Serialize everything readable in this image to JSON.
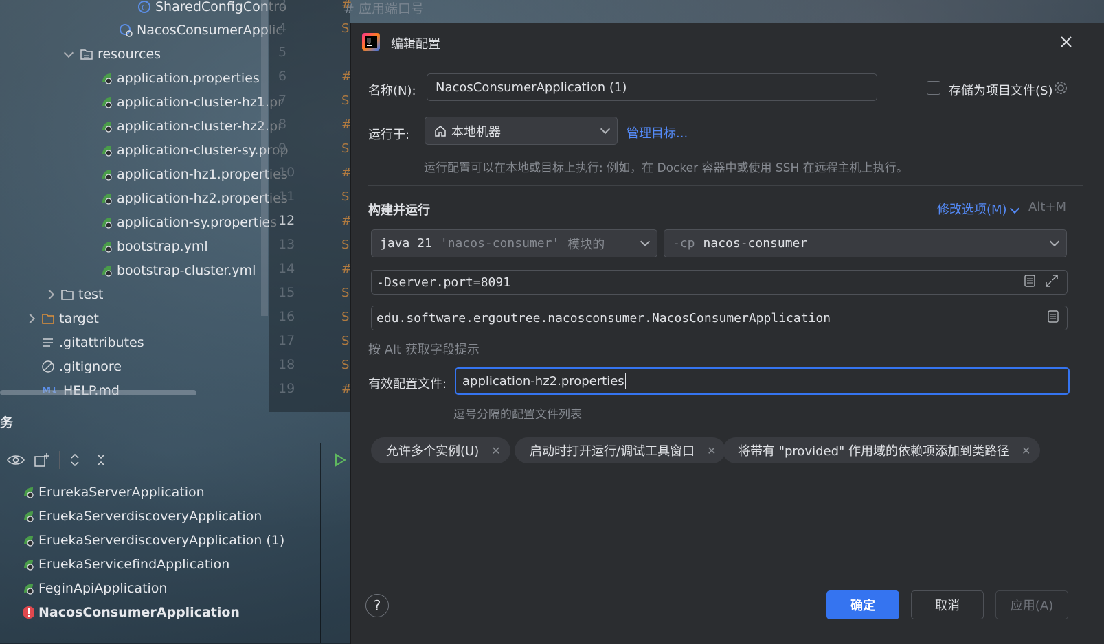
{
  "project_tree": {
    "items": [
      {
        "label": "SharedConfigContro",
        "icon": "spring-class-icon"
      },
      {
        "label": "NacosConsumerApplic",
        "icon": "spring-app-class-icon"
      },
      {
        "label": "resources",
        "icon": "resources-folder-icon"
      },
      {
        "label": "application.properties",
        "icon": "spring-config-icon"
      },
      {
        "label": "application-cluster-hz1.pr",
        "icon": "spring-config-icon"
      },
      {
        "label": "application-cluster-hz2.pr",
        "icon": "spring-config-icon"
      },
      {
        "label": "application-cluster-sy.prop",
        "icon": "spring-config-icon"
      },
      {
        "label": "application-hz1.properties",
        "icon": "spring-config-icon"
      },
      {
        "label": "application-hz2.properties",
        "icon": "spring-config-icon"
      },
      {
        "label": "application-sy.properties",
        "icon": "spring-config-icon"
      },
      {
        "label": "bootstrap.yml",
        "icon": "spring-config-icon"
      },
      {
        "label": "bootstrap-cluster.yml",
        "icon": "spring-config-icon"
      },
      {
        "label": "test",
        "icon": "folder-icon"
      },
      {
        "label": "target",
        "icon": "folder-icon"
      },
      {
        "label": ".gitattributes",
        "icon": "text-file-icon"
      },
      {
        "label": ".gitignore",
        "icon": "ignore-file-icon"
      },
      {
        "label": "HELP.md",
        "icon": "markdown-icon",
        "badge": "M↓"
      }
    ]
  },
  "editor": {
    "comment": "#  应用端口号",
    "line_numbers": [
      "3",
      "4",
      "5",
      "6",
      "7",
      "8",
      "9",
      "10",
      "11",
      "12",
      "13",
      "14",
      "15",
      "16",
      "17",
      "18",
      "19"
    ],
    "current_line": "12",
    "line_starts": [
      "#",
      "S",
      "",
      "#",
      "S",
      "#",
      "S",
      "#",
      "S",
      "#",
      "S",
      "#",
      "S",
      "S",
      "S",
      "S",
      "#"
    ]
  },
  "services": {
    "title": "务",
    "items": [
      {
        "label": "ErurekaServerApplication"
      },
      {
        "label": "ErurekaServerdiscoveryApplication"
      },
      {
        "label": "ErurekaServerdiscoveryApplication (1)"
      },
      {
        "label": "ErurekaServicefindApplication"
      },
      {
        "label": "FeginApiApplication"
      },
      {
        "label": "NacosConsumerApplication",
        "status": "error"
      }
    ],
    "labels": [
      "ErurekaServerApplication",
      "EruekaServerdiscoveryApplication",
      "EruekaServerdiscoveryApplication (1)",
      "EruekaServicefindApplication",
      "FeginApiApplication",
      "NacosConsumerApplication"
    ]
  },
  "dialog": {
    "title": "编辑配置",
    "name_label": "名称(N):",
    "name_value": "NacosConsumerApplication (1)",
    "store_label": "存储为项目文件(S)",
    "run_on_label": "运行于:",
    "run_on_value": "本地机器",
    "manage_targets": "管理目标...",
    "run_on_hint": "运行配置可以在本地或目标上执行: 例如，在 Docker 容器中或使用 SSH 在远程主机上执行。",
    "section_title": "构建并运行",
    "modify_options": "修改选项(M)",
    "modify_shortcut": "Alt+M",
    "jdk_java": "java 21",
    "jdk_module": "'nacos-consumer'",
    "jdk_suffix": "模块的",
    "cp_flag": "-cp",
    "cp_value": "nacos-consumer",
    "vm_options": "-Dserver.port=8091",
    "main_class": "edu.software.ergoutree.nacosconsumer.NacosConsumerApplication",
    "alt_hint": "按 Alt 获取字段提示",
    "profiles_label": "有效配置文件:",
    "profiles_value": "application-hz2.properties",
    "profiles_hint": "逗号分隔的配置文件列表",
    "chips": [
      "允许多个实例(U)",
      "启动时打开运行/调试工具窗口",
      "将带有 \"provided\" 作用域的依赖项添加到类路径"
    ],
    "help": "?",
    "ok": "确定",
    "cancel": "取消",
    "apply": "应用(A)",
    "colors": {
      "accent": "#3574f0",
      "link": "#548af7",
      "background": "#2b2d30"
    }
  }
}
